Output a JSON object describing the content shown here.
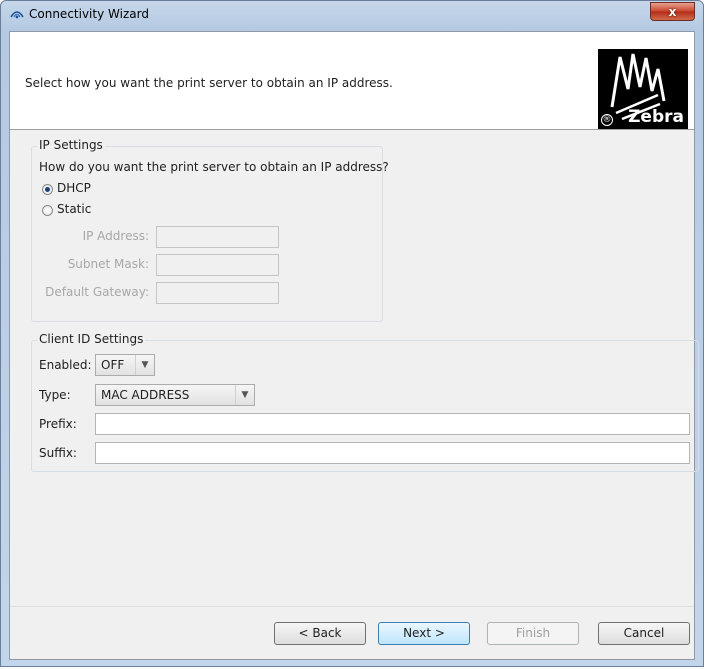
{
  "window": {
    "title": "Connectivity Wizard",
    "close_label": "x"
  },
  "header": {
    "instruction": "Select how you want the print server to obtain an IP address.",
    "logo_text": "Zebra",
    "logo_mark": "®"
  },
  "ip_settings": {
    "title": "IP Settings",
    "question": "How do you want the print server to obtain an IP address?",
    "options": [
      {
        "label": "DHCP",
        "checked": true
      },
      {
        "label": "Static",
        "checked": false
      }
    ],
    "fields": [
      {
        "label": "IP Address:",
        "value": ""
      },
      {
        "label": "Subnet Mask:",
        "value": ""
      },
      {
        "label": "Default Gateway:",
        "value": ""
      }
    ]
  },
  "client_id": {
    "title": "Client ID Settings",
    "enabled_label": "Enabled:",
    "enabled_value": "OFF",
    "type_label": "Type:",
    "type_value": "MAC ADDRESS",
    "prefix_label": "Prefix:",
    "prefix_value": "",
    "suffix_label": "Suffix:",
    "suffix_value": ""
  },
  "buttons": {
    "back": "< Back",
    "next": "Next >",
    "finish": "Finish",
    "cancel": "Cancel"
  },
  "colors": {
    "window_frame": "#c6d7ea",
    "close_button": "#c8432b",
    "dialog_bg": "#f0f0f0",
    "radio_dot": "#1c3f7a"
  }
}
